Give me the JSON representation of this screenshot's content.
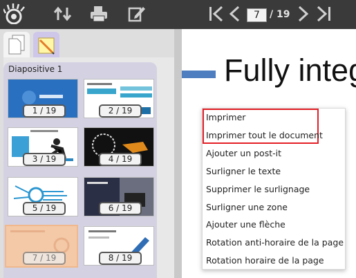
{
  "toolbar": {
    "icons": [
      "eye-logo-icon",
      "sort-arrows-icon",
      "printer-icon",
      "edit-icon",
      "first-page-icon",
      "previous-page-icon",
      "next-page-icon",
      "last-page-icon"
    ],
    "page_current": "7",
    "page_total": "/ 19"
  },
  "sidebar": {
    "tabs": [
      "pages-tab",
      "notes-tab"
    ],
    "group_title": "Diapositive 1",
    "thumbnails": [
      {
        "label": "1 / 19"
      },
      {
        "label": "2 / 19"
      },
      {
        "label": "3 / 19"
      },
      {
        "label": "4 / 19"
      },
      {
        "label": "5 / 19"
      },
      {
        "label": "6 / 19"
      },
      {
        "label": "7 / 19"
      },
      {
        "label": "8 / 19"
      }
    ]
  },
  "document": {
    "title": "Fully integ"
  },
  "context_menu": {
    "items": [
      "Imprimer",
      "Imprimer tout le document",
      "Ajouter un post-it",
      "Surligner le texte",
      "Supprimer le surlignage",
      "Surligner une zone",
      "Ajouter une flèche",
      "Rotation anti-horaire de la page",
      "Rotation horaire de la page"
    ],
    "highlight_color": "#e41e26"
  },
  "colors": {
    "toolbar_bg": "#3a3a3a",
    "accent_bar": "#4f7ec0"
  }
}
